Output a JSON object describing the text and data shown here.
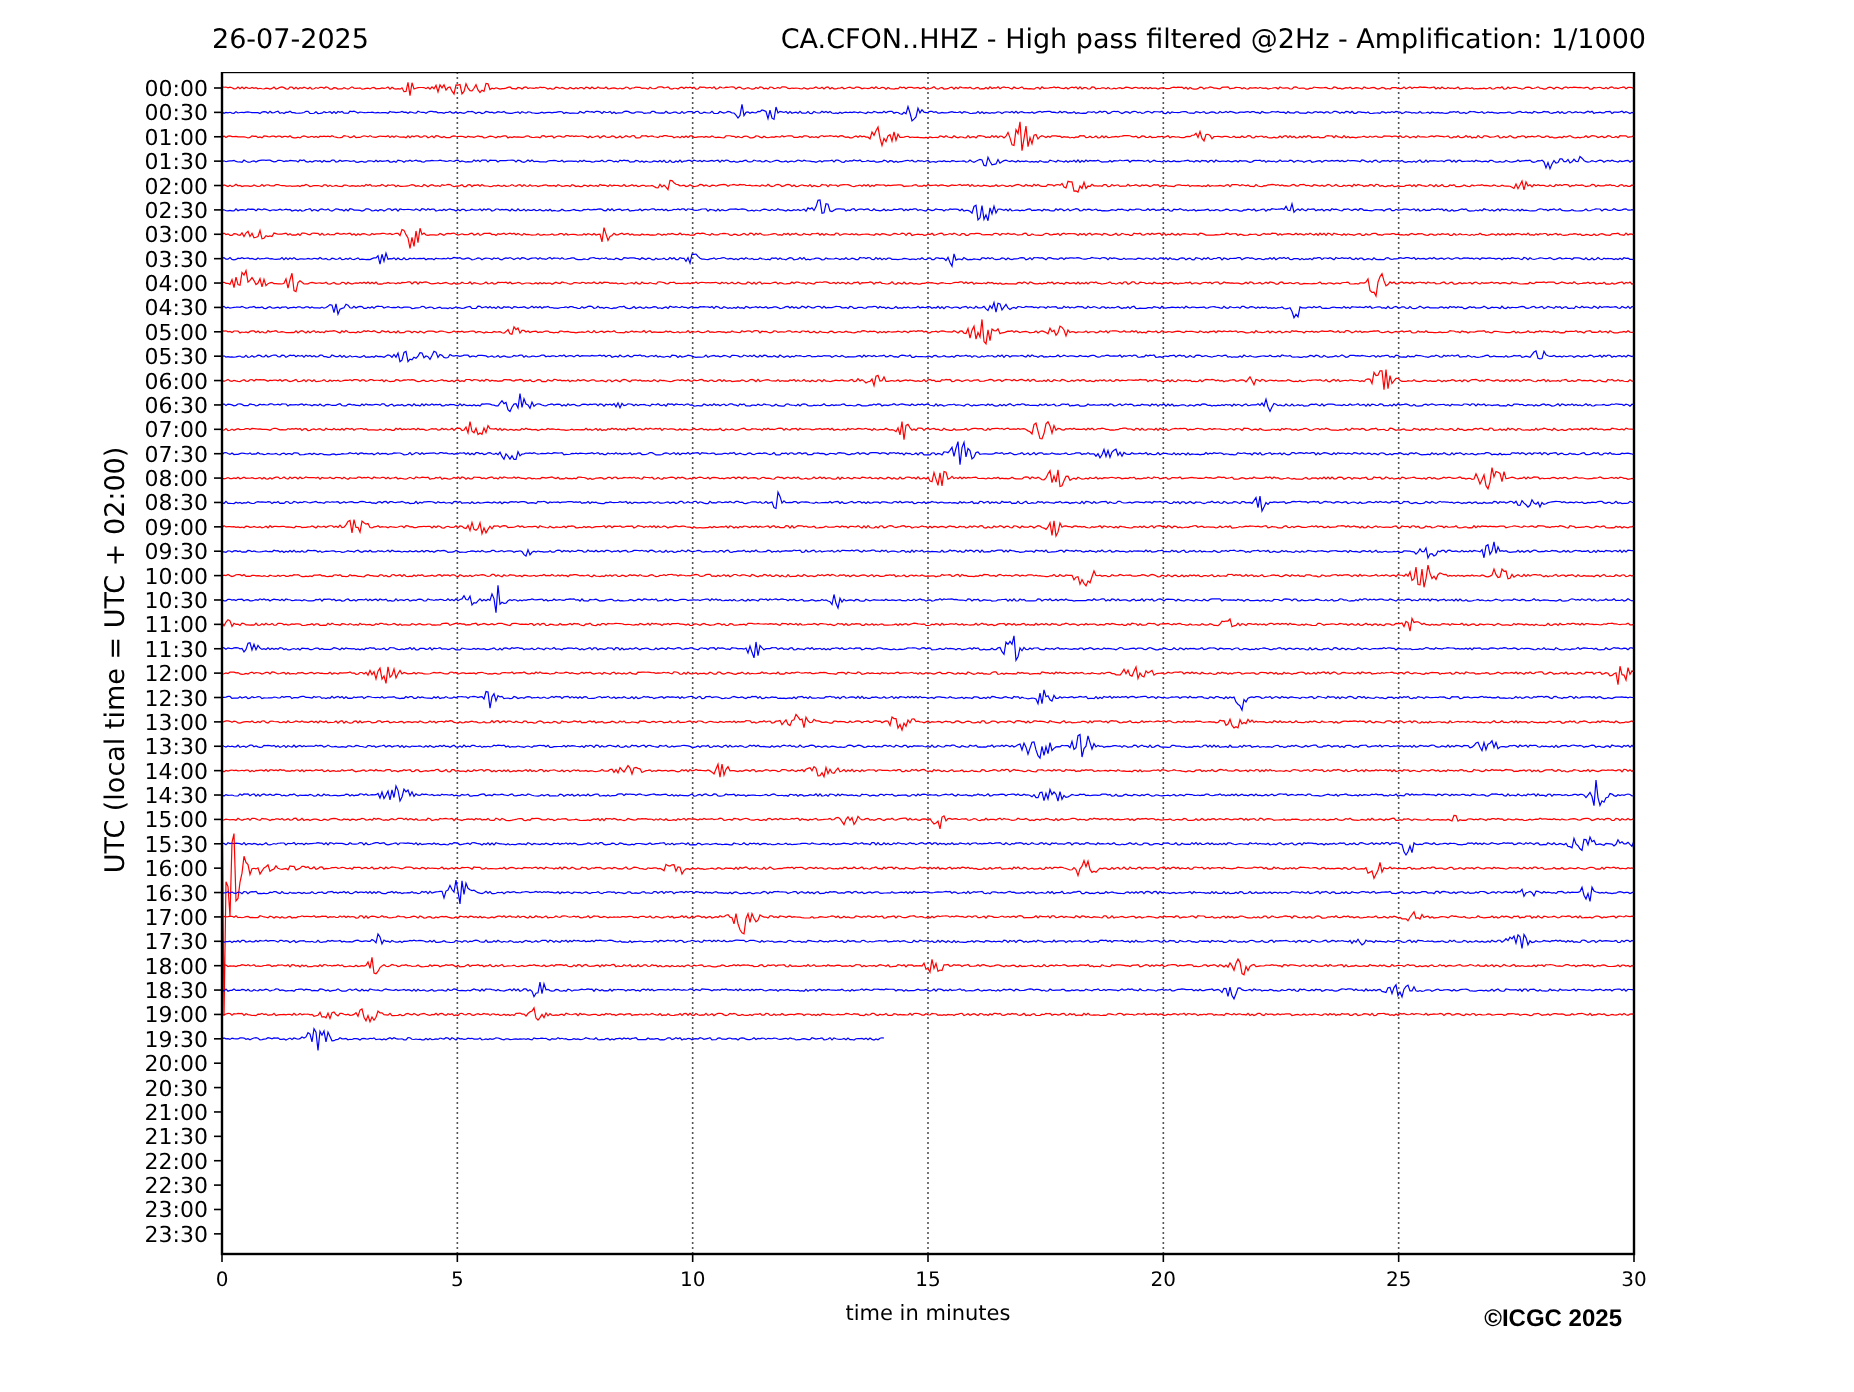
{
  "date": "26-07-2025",
  "title": "CA.CFON..HHZ - High pass filtered @2Hz - Amplification: 1/1000",
  "ylabel": "UTC (local time = UTC + 02:00)",
  "xlabel": "time in minutes",
  "copyright": "©ICGC 2025",
  "xticks": [
    "0",
    "5",
    "10",
    "15",
    "20",
    "25",
    "30"
  ],
  "yticks": [
    "00:00",
    "00:30",
    "01:00",
    "01:30",
    "02:00",
    "02:30",
    "03:00",
    "03:30",
    "04:00",
    "04:30",
    "05:00",
    "05:30",
    "06:00",
    "06:30",
    "07:00",
    "07:30",
    "08:00",
    "08:30",
    "09:00",
    "09:30",
    "10:00",
    "10:30",
    "11:00",
    "11:30",
    "12:00",
    "12:30",
    "13:00",
    "13:30",
    "14:00",
    "14:30",
    "15:00",
    "15:30",
    "16:00",
    "16:30",
    "17:00",
    "17:30",
    "18:00",
    "18:30",
    "19:00",
    "19:30",
    "20:00",
    "20:30",
    "21:00",
    "21:30",
    "22:00",
    "22:30",
    "23:00",
    "23:30"
  ],
  "traces": [
    {
      "color": "#ff0000",
      "level": 1
    },
    {
      "color": "#0000ff",
      "level": 1
    },
    {
      "color": "#ff0000",
      "level": 1
    },
    {
      "color": "#0000ff",
      "level": 1
    },
    {
      "color": "#ff0000",
      "level": 1
    },
    {
      "color": "#0000ff",
      "level": 1
    },
    {
      "color": "#ff0000",
      "level": 1
    },
    {
      "color": "#0000ff",
      "level": 1
    },
    {
      "color": "#ff0000",
      "level": 1
    },
    {
      "color": "#0000ff",
      "level": 1
    },
    {
      "color": "#ff0000",
      "level": 1
    },
    {
      "color": "#0000ff",
      "level": 1
    },
    {
      "color": "#ff0000",
      "level": 1
    },
    {
      "color": "#0000ff",
      "level": 1
    },
    {
      "color": "#ff0000",
      "level": 1
    },
    {
      "color": "#0000ff",
      "level": 1
    },
    {
      "color": "#ff0000",
      "level": 1
    },
    {
      "color": "#0000ff",
      "level": 1
    },
    {
      "color": "#ff0000",
      "level": 1
    },
    {
      "color": "#0000ff",
      "level": 1
    },
    {
      "color": "#ff0000",
      "level": 1
    },
    {
      "color": "#0000ff",
      "level": 1
    },
    {
      "color": "#ff0000",
      "level": 1
    },
    {
      "color": "#0000ff",
      "level": 1
    },
    {
      "color": "#ff0000",
      "level": 1
    },
    {
      "color": "#0000ff",
      "level": 1
    },
    {
      "color": "#ff0000",
      "level": 1
    },
    {
      "color": "#0000ff",
      "level": 1
    },
    {
      "color": "#ff0000",
      "level": 1
    },
    {
      "color": "#0000ff",
      "level": 1
    },
    {
      "color": "#ff0000",
      "level": 1
    },
    {
      "color": "#0000ff",
      "level": 1
    },
    {
      "color": "#ff0000",
      "level": 1
    },
    {
      "color": "#0000ff",
      "level": 1
    },
    {
      "color": "#ff0000",
      "level": 1
    },
    {
      "color": "#0000ff",
      "level": 1
    },
    {
      "color": "#ff0000",
      "level": 1
    },
    {
      "color": "#0000ff",
      "level": 1
    },
    {
      "color": "#ff0000",
      "level": 1
    },
    {
      "color": "#0000ff",
      "level": 0.47
    }
  ]
}
